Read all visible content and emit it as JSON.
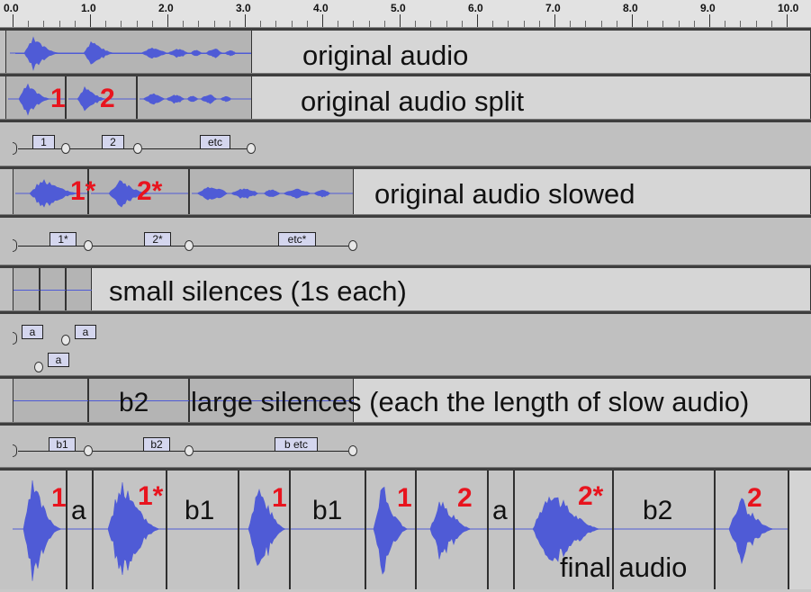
{
  "ruler": {
    "ticks": [
      "0.0",
      "1.0",
      "2.0",
      "3.0",
      "4.0",
      "5.0",
      "6.0",
      "7.0",
      "8.0",
      "9.0",
      "10.0"
    ]
  },
  "tracks": {
    "original": {
      "label": "original audio"
    },
    "split": {
      "label": "original audio split",
      "nums": [
        "1",
        "2"
      ]
    },
    "labels1": {
      "boxes": [
        "1",
        "2",
        "etc"
      ]
    },
    "slowed": {
      "label": "original audio slowed",
      "nums": [
        "1*",
        "2*"
      ]
    },
    "labels2": {
      "boxes": [
        "1*",
        "2*",
        "etc*"
      ]
    },
    "small_silences": {
      "label": "small silences (1s each)"
    },
    "labels3": {
      "boxes": [
        "a",
        "a",
        "a"
      ]
    },
    "large_silences": {
      "label": "large silences (each the length of slow audio)",
      "segment": "b2"
    },
    "labels4": {
      "boxes": [
        "b1",
        "b2",
        "b etc"
      ]
    },
    "final": {
      "label": "final audio",
      "segments": [
        "1",
        "a",
        "1*",
        "b1",
        "1",
        "b1",
        "1",
        "2",
        "a",
        "2*",
        "b2",
        "2"
      ]
    }
  },
  "colors": {
    "waveform": "#4f5bd6",
    "red_number": "#e8141e",
    "label_box": "#d4d6ee"
  }
}
